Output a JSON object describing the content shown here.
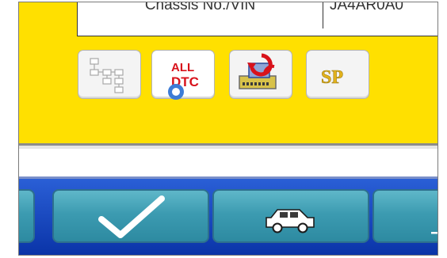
{
  "info_table": {
    "label": "Chassis No./VIN",
    "value": "JA4AR0A0"
  },
  "function_icons": [
    {
      "name": "system-tree-icon"
    },
    {
      "name": "all-dtc-icon",
      "text_line1": "ALL",
      "text_line2": "DTC"
    },
    {
      "name": "ecu-reprogram-icon"
    },
    {
      "name": "special-function-icon",
      "text": "SP"
    }
  ],
  "toolbar": [
    {
      "name": "confirm-check-icon"
    },
    {
      "name": "vehicle-icon"
    }
  ],
  "colors": {
    "header_bg": "#ffe000",
    "toolbar_bg": "#1a49c2",
    "toolbar_button": "#3c9bb1",
    "dtc_red": "#d8121b",
    "sp_gold": "#e3b21c"
  }
}
